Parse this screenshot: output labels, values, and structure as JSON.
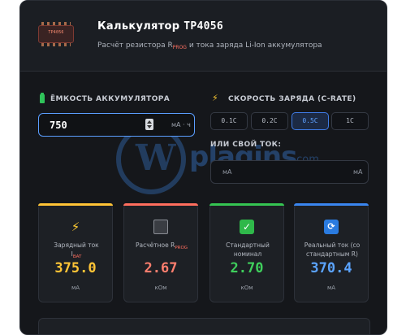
{
  "header": {
    "chip_label": "TP4056",
    "title_prefix": "Калькулятор",
    "title_model": "TP4056",
    "subtitle_pre": "Расчёт резистора R",
    "subtitle_sub": "PROG",
    "subtitle_post": " и тока заряда Li-Ion аккумулятора"
  },
  "capacity": {
    "label": "ЁМКОСТЬ АККУМУЛЯТОРА",
    "value": "750",
    "unit": "мА · ч"
  },
  "rate": {
    "label": "СКОРОСТЬ ЗАРЯДА (C-RATE)",
    "options": [
      "0.1C",
      "0.2C",
      "0.5C",
      "1C"
    ],
    "selected": "0.5C"
  },
  "custom": {
    "label": "ИЛИ СВОЙ ТОК:",
    "placeholder": "мА",
    "unit": "мА"
  },
  "results": [
    {
      "label": "Зарядный ток",
      "label_sub_pre": "I",
      "label_sub": "BAT",
      "value": "375.0",
      "unit": "мА",
      "color": "#ffc436",
      "bar": "#ffc436"
    },
    {
      "label_pre": "Расчётное R",
      "label_sub": "PROG",
      "value": "2.67",
      "unit": "кОм",
      "color": "#ff7e6e",
      "bar": "#ff6e5e"
    },
    {
      "label": "Стандартный номинал",
      "value": "2.70",
      "unit": "кОм",
      "color": "#3fcf5c",
      "bar": "#35c552"
    },
    {
      "label": "Реальный ток (со стандартным R)",
      "value": "370.4",
      "unit": "мА",
      "color": "#5ba4ff",
      "bar": "#3a86f0"
    }
  ],
  "watermark": {
    "text": "plagins",
    "suffix": ".com"
  },
  "colors": {
    "accent": "#5b9eff",
    "background": "#15171b"
  }
}
